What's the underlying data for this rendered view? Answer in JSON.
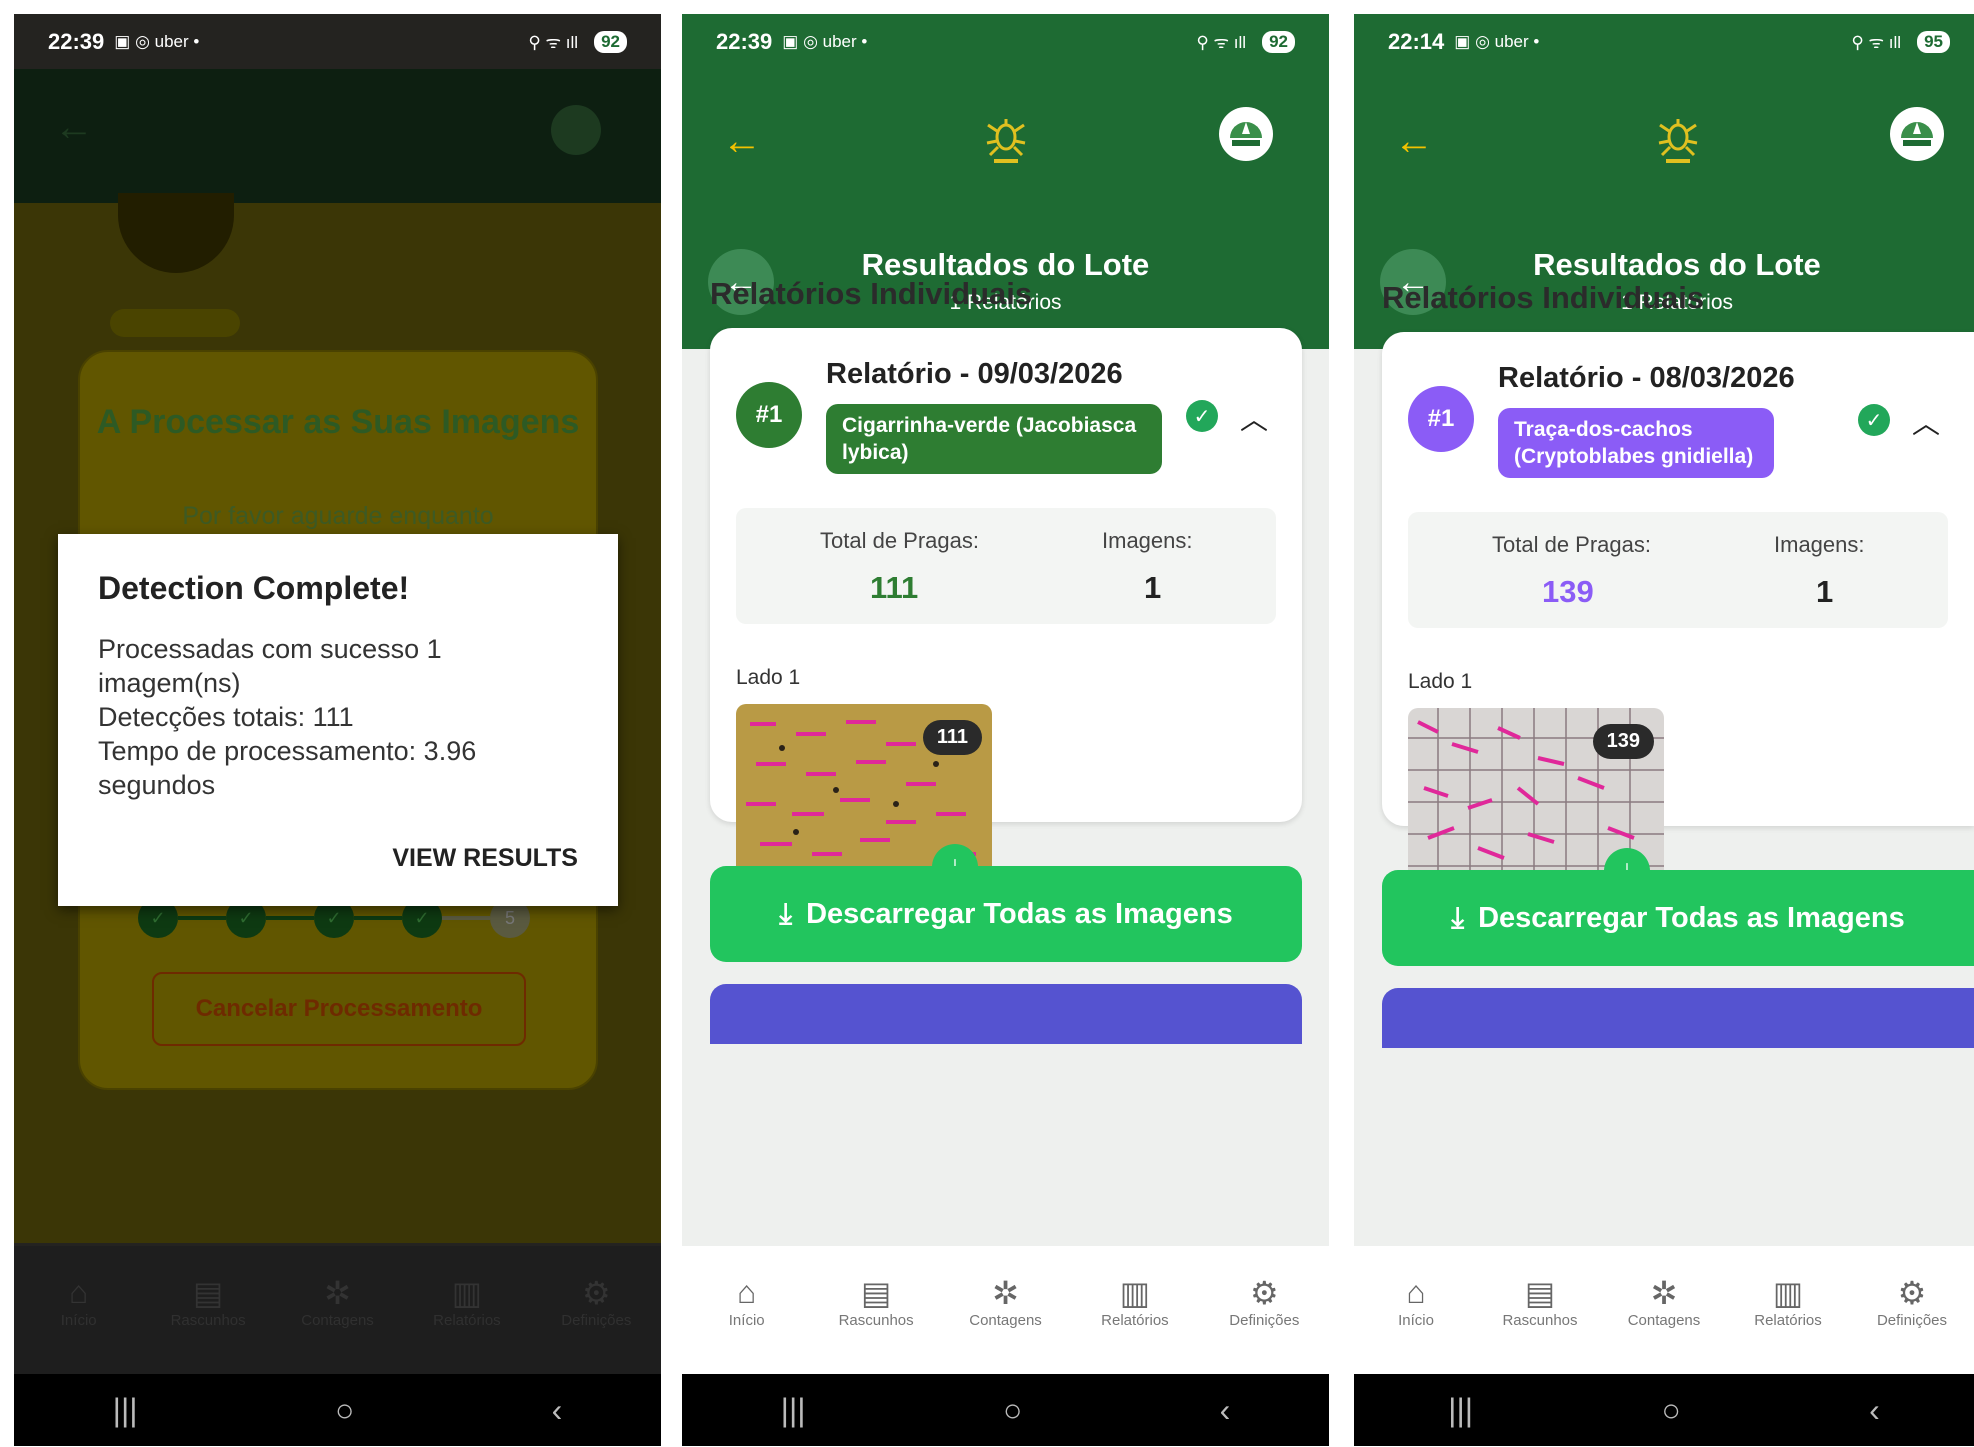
{
  "phones": [
    {
      "status": {
        "time": "22:39",
        "icons": "▣ ◎ uber •",
        "battery": "92"
      },
      "bg_card": {
        "title": "A Processar as Suas Imagens",
        "subtitle": "Por favor aguarde enquanto",
        "cancel_label": "Cancelar Processamento"
      },
      "steps": [
        "✓",
        "✓",
        "✓",
        "✓",
        "5"
      ],
      "dialog": {
        "title": "Detection Complete!",
        "message": "Processadas com sucesso 1 imagem(ns)\nDetecções totais: 111\nTempo de processamento: 3.96 segundos",
        "button": "VIEW RESULTS"
      }
    },
    {
      "status": {
        "time": "22:39",
        "icons": "▣ ◎ uber •",
        "battery": "92"
      },
      "header": {
        "title": "Resultados do Lote",
        "subtitle": "1 Relatórios"
      },
      "section_title": "Relatórios Individuais",
      "report": {
        "number": "#1",
        "title": "Relatório - 09/03/2026",
        "pest_tag": "Cigarrinha-verde (Jacobiasca lybica)",
        "total_label": "Total de Pragas:",
        "total_value": "111",
        "images_label": "Imagens:",
        "images_value": "1",
        "side_label": "Lado 1",
        "thumb_count": "111"
      },
      "download_all": "Descarregar Todas as Imagens",
      "accent": "#2e7d32"
    },
    {
      "status": {
        "time": "22:14",
        "icons": "▣ ◎ uber •",
        "battery": "95"
      },
      "header": {
        "title": "Resultados do Lote",
        "subtitle": "1 Relatórios"
      },
      "section_title": "Relatórios Individuais",
      "report": {
        "number": "#1",
        "title": "Relatório - 08/03/2026",
        "pest_tag": "Traça-dos-cachos (Cryptoblabes gnidiella)",
        "total_label": "Total de Pragas:",
        "total_value": "139",
        "images_label": "Imagens:",
        "images_value": "1",
        "side_label": "Lado 1",
        "thumb_count": "139"
      },
      "download_all": "Descarregar Todas as Imagens",
      "accent": "#8b5cf6"
    }
  ],
  "bottom_nav": [
    {
      "label": "Início",
      "icon": "home-icon"
    },
    {
      "label": "Rascunhos",
      "icon": "document-icon"
    },
    {
      "label": "Contagens",
      "icon": "bug-icon"
    },
    {
      "label": "Relatórios",
      "icon": "bar-chart-icon"
    },
    {
      "label": "Definições",
      "icon": "gear-icon"
    }
  ],
  "colors": {
    "header_green": "#1e6b33",
    "action_green": "#22c55e",
    "purple_bar": "#5553d0",
    "arrow_yellow": "#f2c200"
  }
}
